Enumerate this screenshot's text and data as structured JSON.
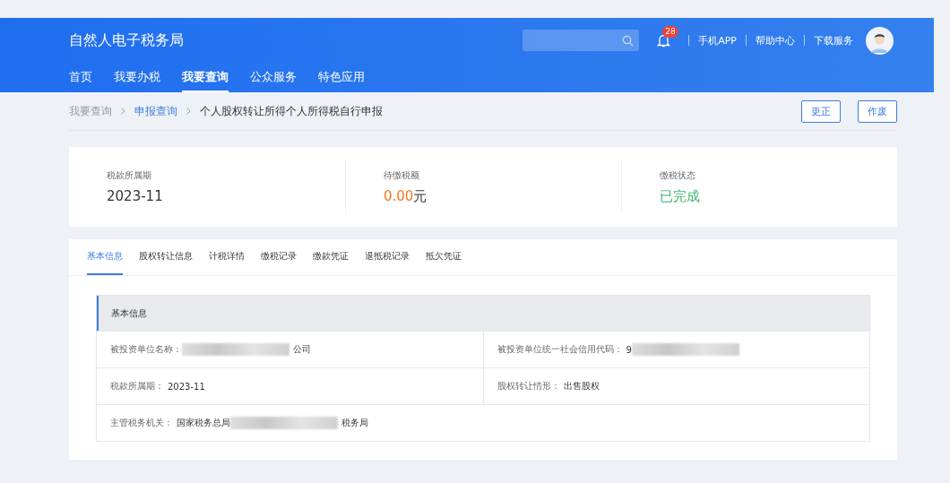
{
  "header": {
    "site_title": "自然人电子税务局",
    "notification_count": "28",
    "links": [
      "手机APP",
      "帮助中心",
      "下载服务"
    ]
  },
  "nav": [
    {
      "label": "首页",
      "selected": false
    },
    {
      "label": "我要办税",
      "selected": false
    },
    {
      "label": "我要查询",
      "selected": true
    },
    {
      "label": "公众服务",
      "selected": false
    },
    {
      "label": "特色应用",
      "selected": false
    }
  ],
  "breadcrumb": [
    {
      "label": "我要查询",
      "kind": "plain"
    },
    {
      "label": "申报查询",
      "kind": "link"
    },
    {
      "label": "个人股权转让所得个人所得税自行申报",
      "kind": "current"
    }
  ],
  "actions": [
    "更正",
    "作废"
  ],
  "summary": [
    {
      "label": "税款所属期",
      "value": "2023-11",
      "kind": "plain"
    },
    {
      "label": "待缴税额",
      "value": "0.00",
      "unit": "元",
      "kind": "amount"
    },
    {
      "label": "缴税状态",
      "value": "已完成",
      "kind": "status"
    }
  ],
  "tabs": [
    {
      "label": "基本信息",
      "selected": true
    },
    {
      "label": "股权转让信息",
      "selected": false
    },
    {
      "label": "计税详情",
      "selected": false
    },
    {
      "label": "缴税记录",
      "selected": false
    },
    {
      "label": "缴款凭证",
      "selected": false
    },
    {
      "label": "退抵税记录",
      "selected": false
    },
    {
      "label": "抵欠凭证",
      "selected": false
    }
  ],
  "section": {
    "title": "基本信息",
    "rows": [
      [
        {
          "label": "被投资单位名称：",
          "redacted": true,
          "value_end": "公司"
        },
        {
          "label": "被投资单位统一社会信用代码：",
          "value_start": "9",
          "redacted": true
        }
      ],
      [
        {
          "label": "税款所属期：",
          "value_start": "2023-11",
          "redacted": false
        },
        {
          "label": "股权转让情形：",
          "value_start": "出售股权",
          "redacted": false
        }
      ],
      [
        {
          "label": "主管税务机关：",
          "value_start": "国家税务总局",
          "redacted": true,
          "value_end": "税务局"
        }
      ]
    ]
  }
}
